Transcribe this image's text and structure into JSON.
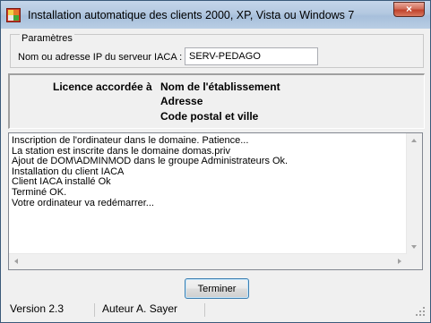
{
  "window": {
    "title": "Installation automatique des clients 2000, XP, Vista ou Windows 7",
    "close_glyph": "×",
    "icon": "installer-icon"
  },
  "params": {
    "legend": "Paramètres",
    "server_label": "Nom ou adresse IP du serveur IACA :",
    "server_value": "SERV-PEDAGO"
  },
  "licence": {
    "label": "Licence accordée à",
    "lines": [
      "Nom de l'établissement",
      "Adresse",
      "Code postal et ville"
    ]
  },
  "log": {
    "lines": [
      "Inscription de l'ordinateur dans le domaine. Patience...",
      "La station est inscrite dans le domaine domas.priv",
      "Ajout de DOM\\ADMINMOD dans le groupe Administrateurs Ok.",
      "Installation du client IACA",
      "Client IACA installé Ok",
      "Terminé OK.",
      "Votre ordinateur va redémarrer..."
    ]
  },
  "button": {
    "label": "Terminer"
  },
  "status": {
    "version": "Version 2.3",
    "author": "Auteur A. Sayer"
  },
  "colors": {
    "title_bar": "#b9cde4",
    "close_button": "#c0432c",
    "window_bg": "#f0f0f0"
  }
}
